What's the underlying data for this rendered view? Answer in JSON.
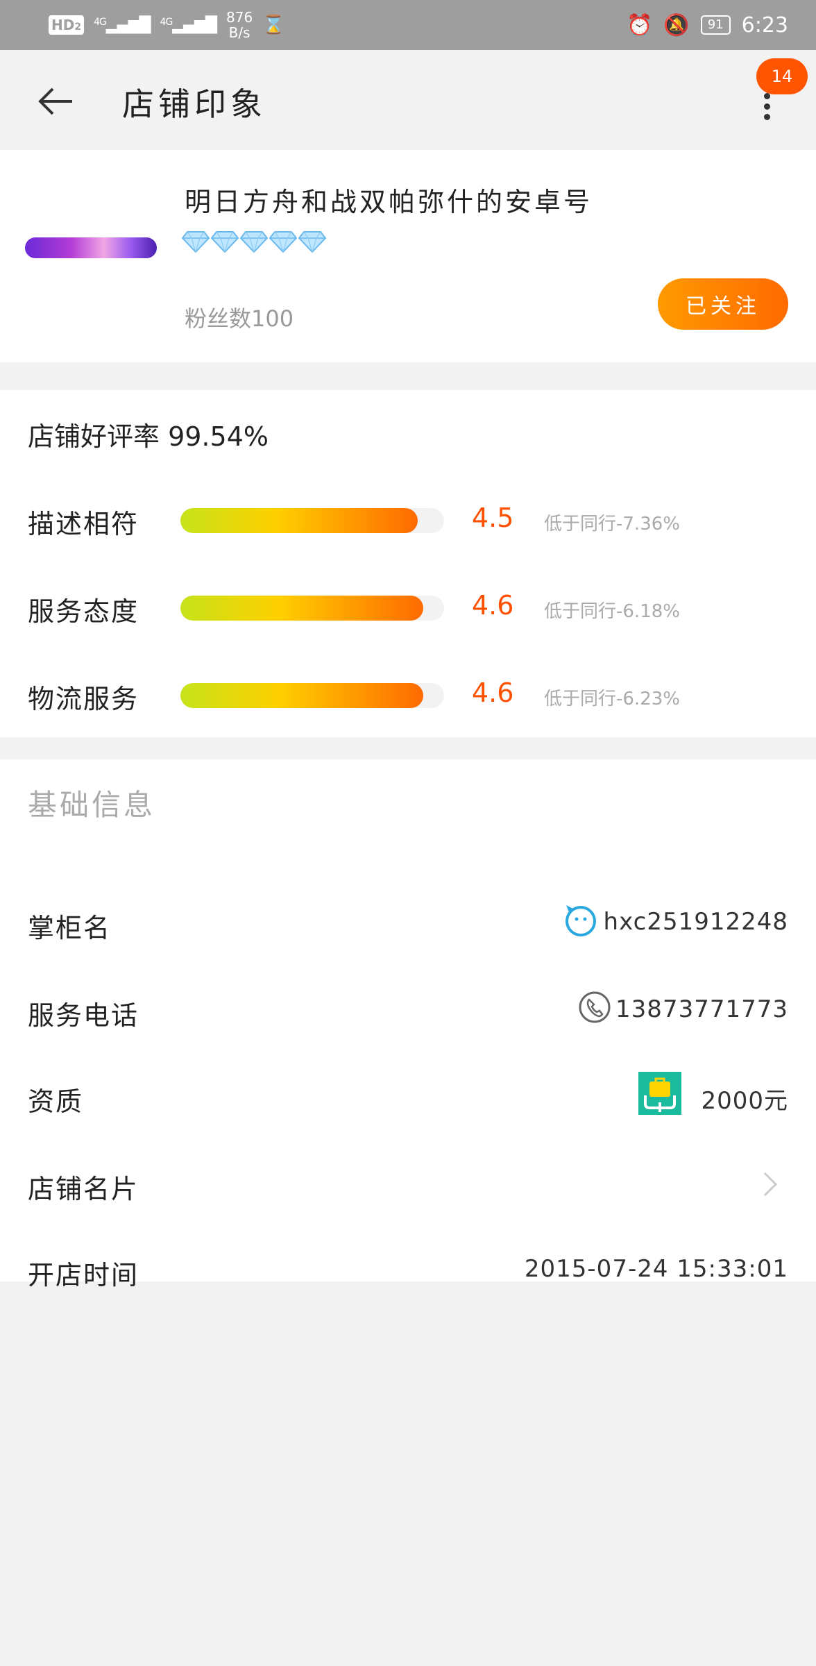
{
  "status_bar": {
    "hd": "HD",
    "hd_sub": "2",
    "net1": "4G",
    "net2": "4G",
    "speed_value": "876",
    "speed_unit": "B/s",
    "battery": "91",
    "time": "6:23"
  },
  "header": {
    "title": "店铺印象",
    "badge": "14"
  },
  "shop": {
    "name": "明日方舟和战双帕弥什的安卓号",
    "diamonds": 5,
    "fans": "粉丝数100",
    "follow_label": "已关注"
  },
  "ratings": {
    "good_rate": "店铺好评率 99.54%",
    "items": [
      {
        "label": "描述相符",
        "score": "4.5",
        "fill": 0.9,
        "compare": "低于同行-7.36%"
      },
      {
        "label": "服务态度",
        "score": "4.6",
        "fill": 0.92,
        "compare": "低于同行-6.18%"
      },
      {
        "label": "物流服务",
        "score": "4.6",
        "fill": 0.92,
        "compare": "低于同行-6.23%"
      }
    ]
  },
  "basic_info": {
    "title": "基础信息",
    "rows": [
      {
        "label": "掌柜名",
        "value": "hxc251912248",
        "icon": "wangwang-icon"
      },
      {
        "label": "服务电话",
        "value": "13873771773",
        "icon": "phone-icon"
      },
      {
        "label": "资质",
        "value": "2000元",
        "icon": "deposit-icon"
      },
      {
        "label": "店铺名片",
        "value": "",
        "icon": "chevron-right-icon"
      },
      {
        "label": "开店时间",
        "value": "2015-07-24 15:33:01",
        "icon": ""
      }
    ]
  },
  "colors": {
    "accent": "#ff6a00",
    "score": "#ff5000",
    "wangwang": "#29a8e0",
    "deposit": "#1aba9c"
  }
}
